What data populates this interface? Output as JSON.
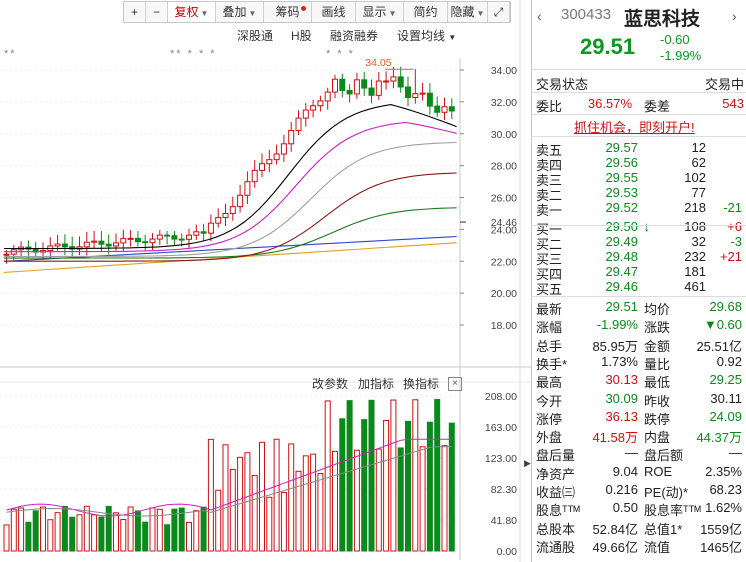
{
  "toolbar": {
    "items": [
      {
        "label": "+",
        "w": 22
      },
      {
        "label": "−",
        "w": 22
      },
      {
        "label": "复权",
        "w": 48,
        "active": true,
        "caret": true
      },
      {
        "label": "叠加",
        "w": 48,
        "caret": true
      },
      {
        "label": "筹码",
        "w": 48,
        "dot": true
      },
      {
        "label": "画线",
        "w": 44
      },
      {
        "label": "显示",
        "w": 48,
        "caret": true
      },
      {
        "label": "简约",
        "w": 44
      },
      {
        "label": "隐藏",
        "w": 40,
        "caret": true
      },
      {
        "label": "⤢",
        "w": 22
      }
    ]
  },
  "submenu": {
    "hk_connect": "深股通",
    "h_share": "H股",
    "margin": "融资融券",
    "ma_settings": "设置均线"
  },
  "stars": {
    "a": "**",
    "b": "** * * *",
    "c": "* * *"
  },
  "price_axis": [
    "34.00",
    "32.00",
    "30.00",
    "28.00",
    "26.00",
    "24.46",
    "24.00",
    "22.00",
    "20.00",
    "18.00"
  ],
  "high_marker": "34.05",
  "volume_axis": [
    "208.00",
    "163.00",
    "123.00",
    "82.30",
    "41.80",
    "0.00"
  ],
  "indicator_menu": {
    "change_params": "改参数",
    "add_indicator": "加指标",
    "switch_indicator": "换指标",
    "close": "×"
  },
  "quote": {
    "code": "300433",
    "name": "蓝思科技",
    "price": "29.51",
    "change": "-0.60",
    "change_pct": "-1.99%",
    "status_label": "交易状态",
    "status_value": "交易中",
    "webi_label": "委比",
    "webi_value": "36.57%",
    "weicha_label": "委差",
    "weicha_value": "543",
    "promo": "抓住机会，即刻开户!"
  },
  "order_book": {
    "asks": [
      {
        "label": "卖五",
        "price": "29.57",
        "vol": "12",
        "delta": ""
      },
      {
        "label": "卖四",
        "price": "29.56",
        "vol": "62",
        "delta": ""
      },
      {
        "label": "卖三",
        "price": "29.55",
        "vol": "102",
        "delta": ""
      },
      {
        "label": "卖二",
        "price": "29.53",
        "vol": "77",
        "delta": ""
      },
      {
        "label": "卖一",
        "price": "29.52",
        "vol": "218",
        "delta": "-21"
      }
    ],
    "bids": [
      {
        "label": "买一",
        "price": "29.50",
        "vol": "108",
        "delta": "+6",
        "arrow": "↓"
      },
      {
        "label": "买二",
        "price": "29.49",
        "vol": "32",
        "delta": "-3"
      },
      {
        "label": "买三",
        "price": "29.48",
        "vol": "232",
        "delta": "+21"
      },
      {
        "label": "买四",
        "price": "29.47",
        "vol": "181",
        "delta": ""
      },
      {
        "label": "买五",
        "price": "29.46",
        "vol": "461",
        "delta": ""
      }
    ]
  },
  "stats": [
    [
      {
        "l": "最新",
        "v": "29.51",
        "c": "green"
      },
      {
        "l": "均价",
        "v": "29.68",
        "c": "green"
      }
    ],
    [
      {
        "l": "涨幅",
        "v": "-1.99%",
        "c": "green"
      },
      {
        "l": "涨跌",
        "v": "▼0.60",
        "c": "green"
      }
    ],
    [
      {
        "l": "总手",
        "v": "85.95万",
        "c": "dk"
      },
      {
        "l": "金额",
        "v": "25.51亿",
        "c": "dk"
      }
    ],
    [
      {
        "l": "换手*",
        "v": "1.73%",
        "c": "dk"
      },
      {
        "l": "量比",
        "v": "0.92",
        "c": "dk"
      }
    ],
    [
      {
        "l": "最高",
        "v": "30.13",
        "c": "red"
      },
      {
        "l": "最低",
        "v": "29.25",
        "c": "green"
      }
    ],
    [
      {
        "l": "今开",
        "v": "30.09",
        "c": "green"
      },
      {
        "l": "昨收",
        "v": "30.11",
        "c": "dk"
      }
    ],
    [
      {
        "l": "涨停",
        "v": "36.13",
        "c": "red"
      },
      {
        "l": "跌停",
        "v": "24.09",
        "c": "green"
      }
    ],
    [
      {
        "l": "外盘",
        "v": "41.58万",
        "c": "red"
      },
      {
        "l": "内盘",
        "v": "44.37万",
        "c": "green"
      }
    ],
    [
      {
        "l": "盘后量",
        "v": "—",
        "c": "dk"
      },
      {
        "l": "盘后额",
        "v": "—",
        "c": "dk"
      }
    ],
    [
      {
        "l": "净资产",
        "v": "9.04",
        "c": "dk"
      },
      {
        "l": "ROE",
        "v": "2.35%",
        "c": "dk"
      }
    ],
    [
      {
        "l": "收益㈢",
        "v": "0.216",
        "c": "dk"
      },
      {
        "l": "PE(动)*",
        "v": "68.23",
        "c": "dk"
      }
    ],
    [
      {
        "l": "股息ᵀᵀᴹ",
        "v": "0.50",
        "c": "dk"
      },
      {
        "l": "股息率ᵀᵀᴹ",
        "v": "1.62%",
        "c": "dk"
      }
    ],
    [
      {
        "l": "总股本",
        "v": "52.84亿",
        "c": "dk"
      },
      {
        "l": "总值1*",
        "v": "1559亿",
        "c": "dk"
      }
    ],
    [
      {
        "l": "流通股",
        "v": "49.66亿",
        "c": "dk"
      },
      {
        "l": "流值",
        "v": "1465亿",
        "c": "dk"
      }
    ]
  ],
  "colors": {
    "up": "#d01010",
    "down": "#0a8a1a",
    "ma5": "#000000",
    "ma10": "#d020c0",
    "ma20": "#a0a0a0",
    "ma30": "#8b1a1a",
    "ma60": "#1a7a1a",
    "ma120": "#2b45c8",
    "ma250": "#e0a020"
  }
}
